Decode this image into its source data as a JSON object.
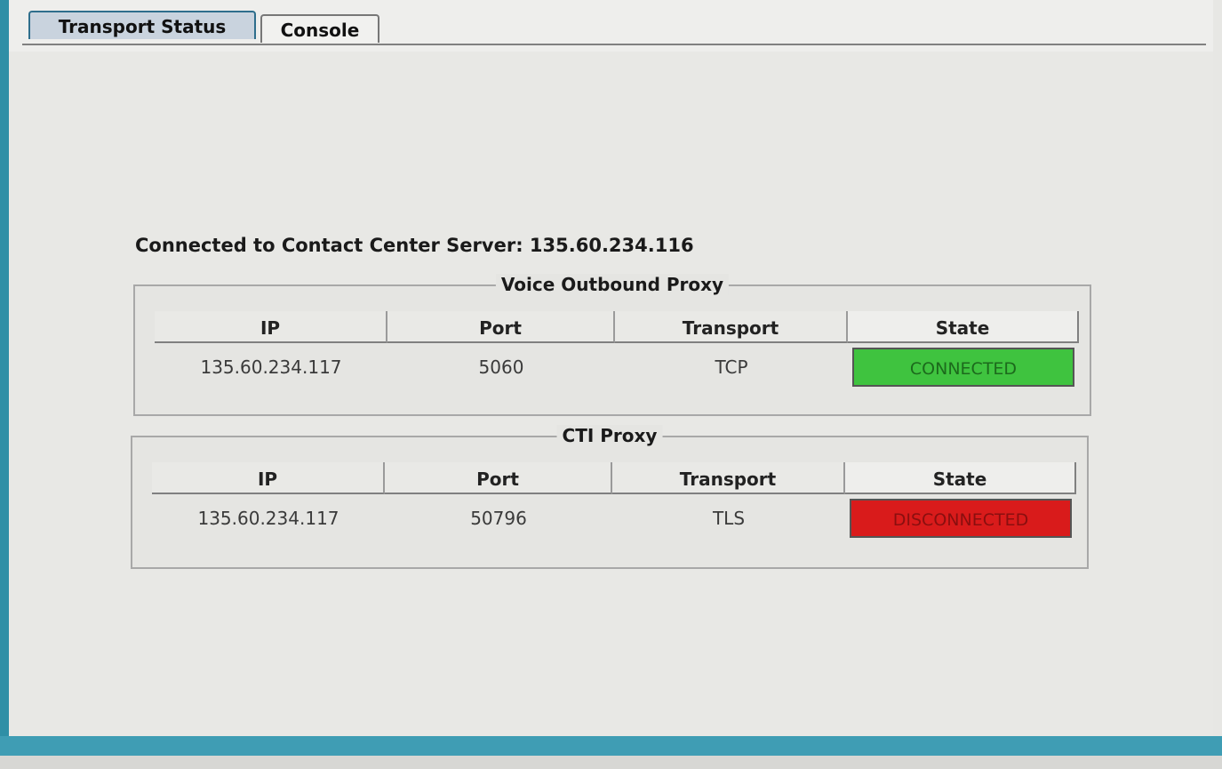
{
  "tabs": [
    {
      "label": "Transport Status"
    },
    {
      "label": "Console"
    }
  ],
  "server_status": "Connected to Contact Center Server: 135.60.234.116",
  "voice_proxy": {
    "title": "Voice Outbound Proxy",
    "headers": {
      "ip": "IP",
      "port": "Port",
      "transport": "Transport",
      "state": "State"
    },
    "row": {
      "ip": "135.60.234.117",
      "port": "5060",
      "transport": "TCP",
      "state": "CONNECTED"
    },
    "state_color": "#3fc33f"
  },
  "cti_proxy": {
    "title": "CTI Proxy",
    "headers": {
      "ip": "IP",
      "port": "Port",
      "transport": "Transport",
      "state": "State"
    },
    "row": {
      "ip": "135.60.234.117",
      "port": "50796",
      "transport": "TLS",
      "state": "DISCONNECTED"
    },
    "state_color": "#d91b1b"
  }
}
